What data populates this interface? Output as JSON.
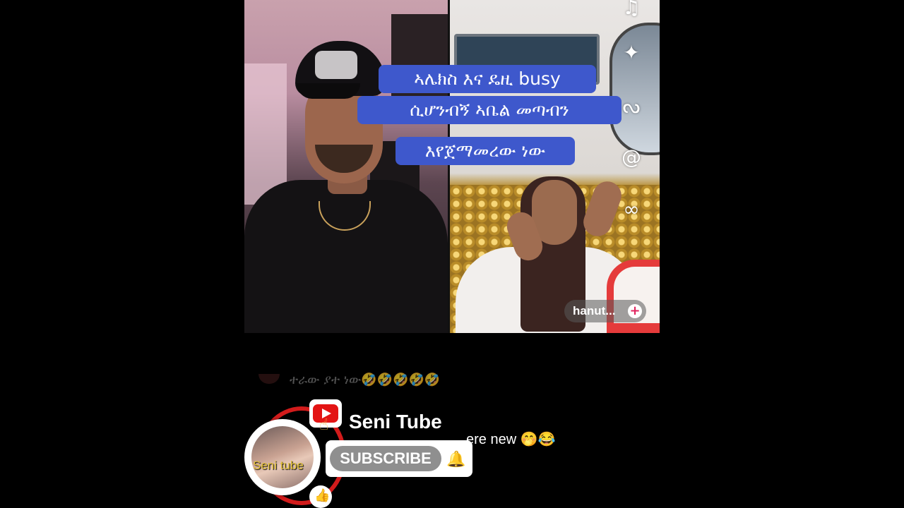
{
  "caption": {
    "line1": "ኣሌክስ እና ዴዚ busy",
    "line2": "ሲሆንብኝ  ኣቤል መጣብን",
    "line3": "እየጀማመረው ነው"
  },
  "live_user": {
    "name": "hanut...",
    "follow_symbol": "+"
  },
  "side_icons": [
    {
      "name": "music-icon",
      "glyph": "♫"
    },
    {
      "name": "sparkles-icon",
      "glyph": "✦"
    },
    {
      "name": "squiggle-icon",
      "glyph": "ᔓ"
    },
    {
      "name": "mention-icon",
      "glyph": "@"
    },
    {
      "name": "link-icon",
      "glyph": "∞"
    }
  ],
  "comments": [
    {
      "text": "ተራው ያተ ነው🤣🤣🤣🤣🤣"
    },
    {
      "text": "ere new 🤭😂"
    }
  ],
  "subscribe_overlay": {
    "channel_name": "Seni Tube",
    "avatar_text": "Seni tube",
    "subscribe_label": "SUBSCRIBE",
    "bell_glyph": "🔔",
    "like_glyph": "👍",
    "accent_color": "#e31414"
  }
}
